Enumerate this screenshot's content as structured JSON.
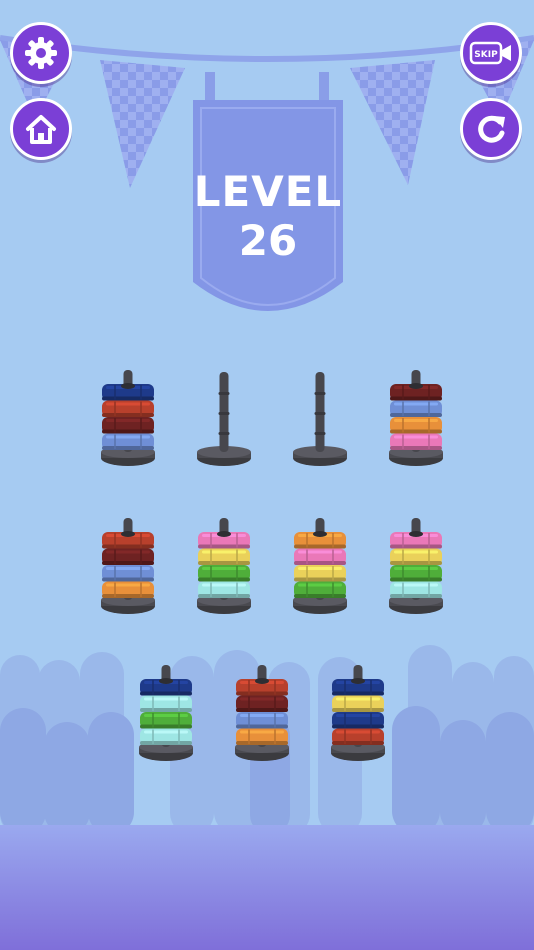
{
  "level": {
    "label": "LEVEL",
    "number": "26"
  },
  "buttons": {
    "settings": {
      "icon": "gear-icon"
    },
    "home": {
      "icon": "home-icon"
    },
    "skip": {
      "icon": "video-icon",
      "label": "SKIP"
    },
    "restart": {
      "icon": "restart-icon"
    }
  },
  "colors": {
    "background": "#a6cbf2",
    "button": "#7b3fd6",
    "navy": "#1e3a8a",
    "red": "#b8402c",
    "maroon": "#6e2222",
    "steel": "#6f8fd6",
    "orange": "#e8903a",
    "pink": "#ea78b8",
    "yellow": "#ead15a",
    "green": "#4fae3a",
    "cyan": "#9ee6e4"
  },
  "stacks": [
    {
      "rings": [
        "steel",
        "maroon",
        "red",
        "navy"
      ]
    },
    {
      "rings": []
    },
    {
      "rings": []
    },
    {
      "rings": [
        "pink",
        "orange",
        "steel",
        "maroon"
      ]
    },
    {
      "rings": [
        "orange",
        "steel",
        "maroon",
        "red"
      ]
    },
    {
      "rings": [
        "cyan",
        "green",
        "yellow",
        "pink"
      ]
    },
    {
      "rings": [
        "green",
        "yellow",
        "pink",
        "orange"
      ]
    },
    {
      "rings": [
        "cyan",
        "green",
        "yellow",
        "pink"
      ]
    },
    {
      "rings": [
        "cyan",
        "green",
        "cyan",
        "navy"
      ]
    },
    {
      "rings": [
        "orange",
        "steel",
        "maroon",
        "red"
      ]
    },
    {
      "rings": [
        "red",
        "navy",
        "yellow",
        "navy"
      ]
    }
  ]
}
